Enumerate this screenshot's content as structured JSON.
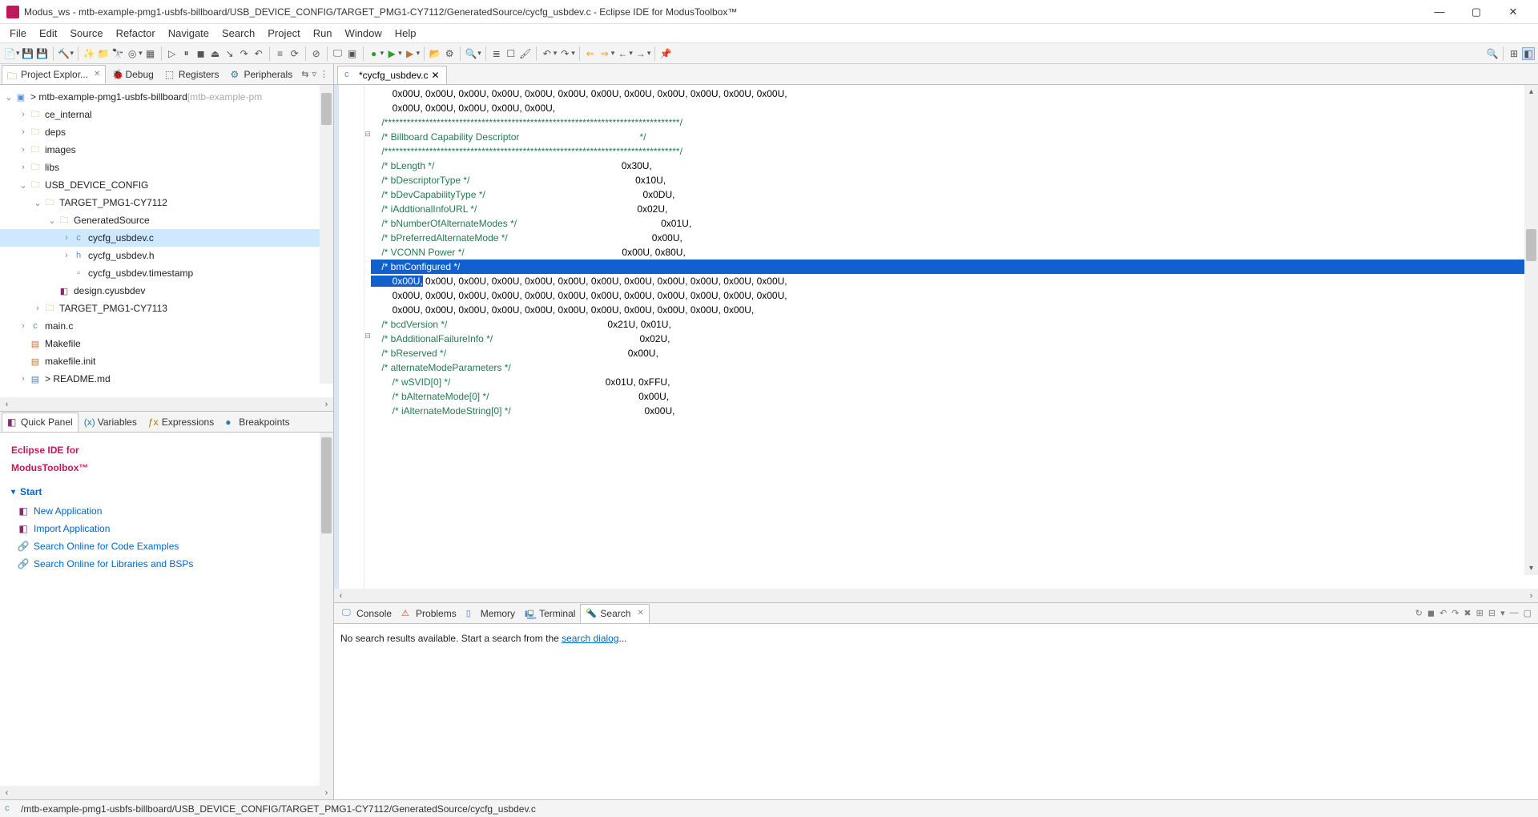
{
  "window": {
    "title": "Modus_ws - mtb-example-pmg1-usbfs-billboard/USB_DEVICE_CONFIG/TARGET_PMG1-CY7112/GeneratedSource/cycfg_usbdev.c - Eclipse IDE for ModusToolbox™",
    "min": "—",
    "max": "▢",
    "close": "✕"
  },
  "menu": [
    "File",
    "Edit",
    "Source",
    "Refactor",
    "Navigate",
    "Search",
    "Project",
    "Run",
    "Window",
    "Help"
  ],
  "left": {
    "tabs": {
      "project_explorer": "Project Explor...",
      "debug": "Debug",
      "registers": "Registers",
      "peripherals": "Peripherals"
    },
    "tree": {
      "root": "> mtb-example-pmg1-usbfs-billboard",
      "root_gray": " [mtb-example-pm",
      "items": [
        {
          "indent": 1,
          "twist": "›",
          "icon": "📁",
          "label": "ce_internal"
        },
        {
          "indent": 1,
          "twist": "›",
          "icon": "📁",
          "label": "deps"
        },
        {
          "indent": 1,
          "twist": "›",
          "icon": "📁",
          "label": "images"
        },
        {
          "indent": 1,
          "twist": "›",
          "icon": "📁",
          "label": "libs"
        },
        {
          "indent": 1,
          "twist": "⌄",
          "icon": "📁",
          "label": "USB_DEVICE_CONFIG"
        },
        {
          "indent": 2,
          "twist": "⌄",
          "icon": "📁",
          "label": "TARGET_PMG1-CY7112"
        },
        {
          "indent": 3,
          "twist": "⌄",
          "icon": "📁",
          "label": "GeneratedSource"
        },
        {
          "indent": 4,
          "twist": "›",
          "icon": "c",
          "label": "cycfg_usbdev.c",
          "sel": true
        },
        {
          "indent": 4,
          "twist": "›",
          "icon": "h",
          "label": "cycfg_usbdev.h"
        },
        {
          "indent": 4,
          "twist": "",
          "icon": "t",
          "label": "cycfg_usbdev.timestamp"
        },
        {
          "indent": 3,
          "twist": "",
          "icon": "d",
          "label": "design.cyusbdev"
        },
        {
          "indent": 2,
          "twist": "›",
          "icon": "📁",
          "label": "TARGET_PMG1-CY7113"
        },
        {
          "indent": 1,
          "twist": "›",
          "icon": "c",
          "label": "main.c"
        },
        {
          "indent": 1,
          "twist": "",
          "icon": "m",
          "label": "Makefile"
        },
        {
          "indent": 1,
          "twist": "",
          "icon": "m",
          "label": "makefile.init"
        },
        {
          "indent": 1,
          "twist": "›",
          "icon": "r",
          "label": "> README.md"
        }
      ]
    },
    "panel2tabs": {
      "quick": "Quick Panel",
      "variables": "Variables",
      "expressions": "Expressions",
      "breakpoints": "Breakpoints"
    },
    "start": {
      "title1": "Eclipse IDE for",
      "title2": "ModusToolbox™",
      "header": "Start",
      "links": [
        "New Application",
        "Import Application",
        "Search Online for Code Examples",
        "Search Online for Libraries and BSPs"
      ]
    }
  },
  "editor": {
    "tabname": "*cycfg_usbdev.c",
    "lines": [
      {
        "t": "        0x00U, 0x00U, 0x00U, 0x00U, 0x00U, 0x00U, 0x00U, 0x00U, 0x00U, 0x00U, 0x00U, 0x00U,",
        "cls": ""
      },
      {
        "t": "        0x00U, 0x00U, 0x00U, 0x00U, 0x00U,",
        "cls": ""
      },
      {
        "t": "",
        "cls": ""
      },
      {
        "t": "    /*******************************************************************************/",
        "cls": "cmt",
        "fold": "-"
      },
      {
        "t": "    /* Billboard Capability Descriptor                                             */",
        "cls": "cmt"
      },
      {
        "t": "    /*******************************************************************************/",
        "cls": "cmt"
      },
      {
        "t": "    /* bLength */                                                                      0x30U,",
        "cls": "cmt"
      },
      {
        "t": "    /* bDescriptorType */                                                              0x10U,",
        "cls": "cmt"
      },
      {
        "t": "    /* bDevCapabilityType */                                                           0x0DU,",
        "cls": "cmt"
      },
      {
        "t": "    /* iAddtionalInfoURL */                                                            0x02U,",
        "cls": "cmt"
      },
      {
        "t": "    /* bNumberOfAlternateModes */                                                      0x01U,",
        "cls": "cmt"
      },
      {
        "t": "    /* bPreferredAlternateMode */                                                      0x00U,",
        "cls": "cmt"
      },
      {
        "t": "    /* VCONN Power */                                                           0x00U, 0x80U,",
        "cls": "cmt"
      },
      {
        "t": "    /* bmConfigured */",
        "cls": "cmt",
        "fullsel": true
      },
      {
        "t": "        0x00U, 0x00U, 0x00U, 0x00U, 0x00U, 0x00U, 0x00U, 0x00U, 0x00U, 0x00U, 0x00U, 0x00U,",
        "cls": "",
        "partialsel": "        0x00U,"
      },
      {
        "t": "        0x00U, 0x00U, 0x00U, 0x00U, 0x00U, 0x00U, 0x00U, 0x00U, 0x00U, 0x00U, 0x00U, 0x00U,",
        "cls": ""
      },
      {
        "t": "        0x00U, 0x00U, 0x00U, 0x00U, 0x00U, 0x00U, 0x00U, 0x00U, 0x00U, 0x00U, 0x00U,",
        "cls": ""
      },
      {
        "t": "    /* bcdVersion */                                                            0x21U, 0x01U,",
        "cls": "cmt",
        "fold": "-"
      },
      {
        "t": "    /* bAdditionalFailureInfo */                                                       0x02U,",
        "cls": "cmt"
      },
      {
        "t": "    /* bReserved */                                                                    0x00U,",
        "cls": "cmt"
      },
      {
        "t": "    /* alternateModeParameters */",
        "cls": "cmt"
      },
      {
        "t": "        /* wSVID[0] */                                                          0x01U, 0xFFU,",
        "cls": "cmt"
      },
      {
        "t": "        /* bAlternateMode[0] */                                                        0x00U,",
        "cls": "cmt"
      },
      {
        "t": "        /* iAlternateModeString[0] */                                                  0x00U,",
        "cls": "cmt"
      }
    ]
  },
  "bottom": {
    "tabs": {
      "console": "Console",
      "problems": "Problems",
      "memory": "Memory",
      "terminal": "Terminal",
      "search": "Search"
    },
    "search_msg_pre": "No search results available. Start a search from the ",
    "search_link": "search dialog",
    "search_msg_post": "..."
  },
  "status": {
    "path": "/mtb-example-pmg1-usbfs-billboard/USB_DEVICE_CONFIG/TARGET_PMG1-CY7112/GeneratedSource/cycfg_usbdev.c"
  }
}
